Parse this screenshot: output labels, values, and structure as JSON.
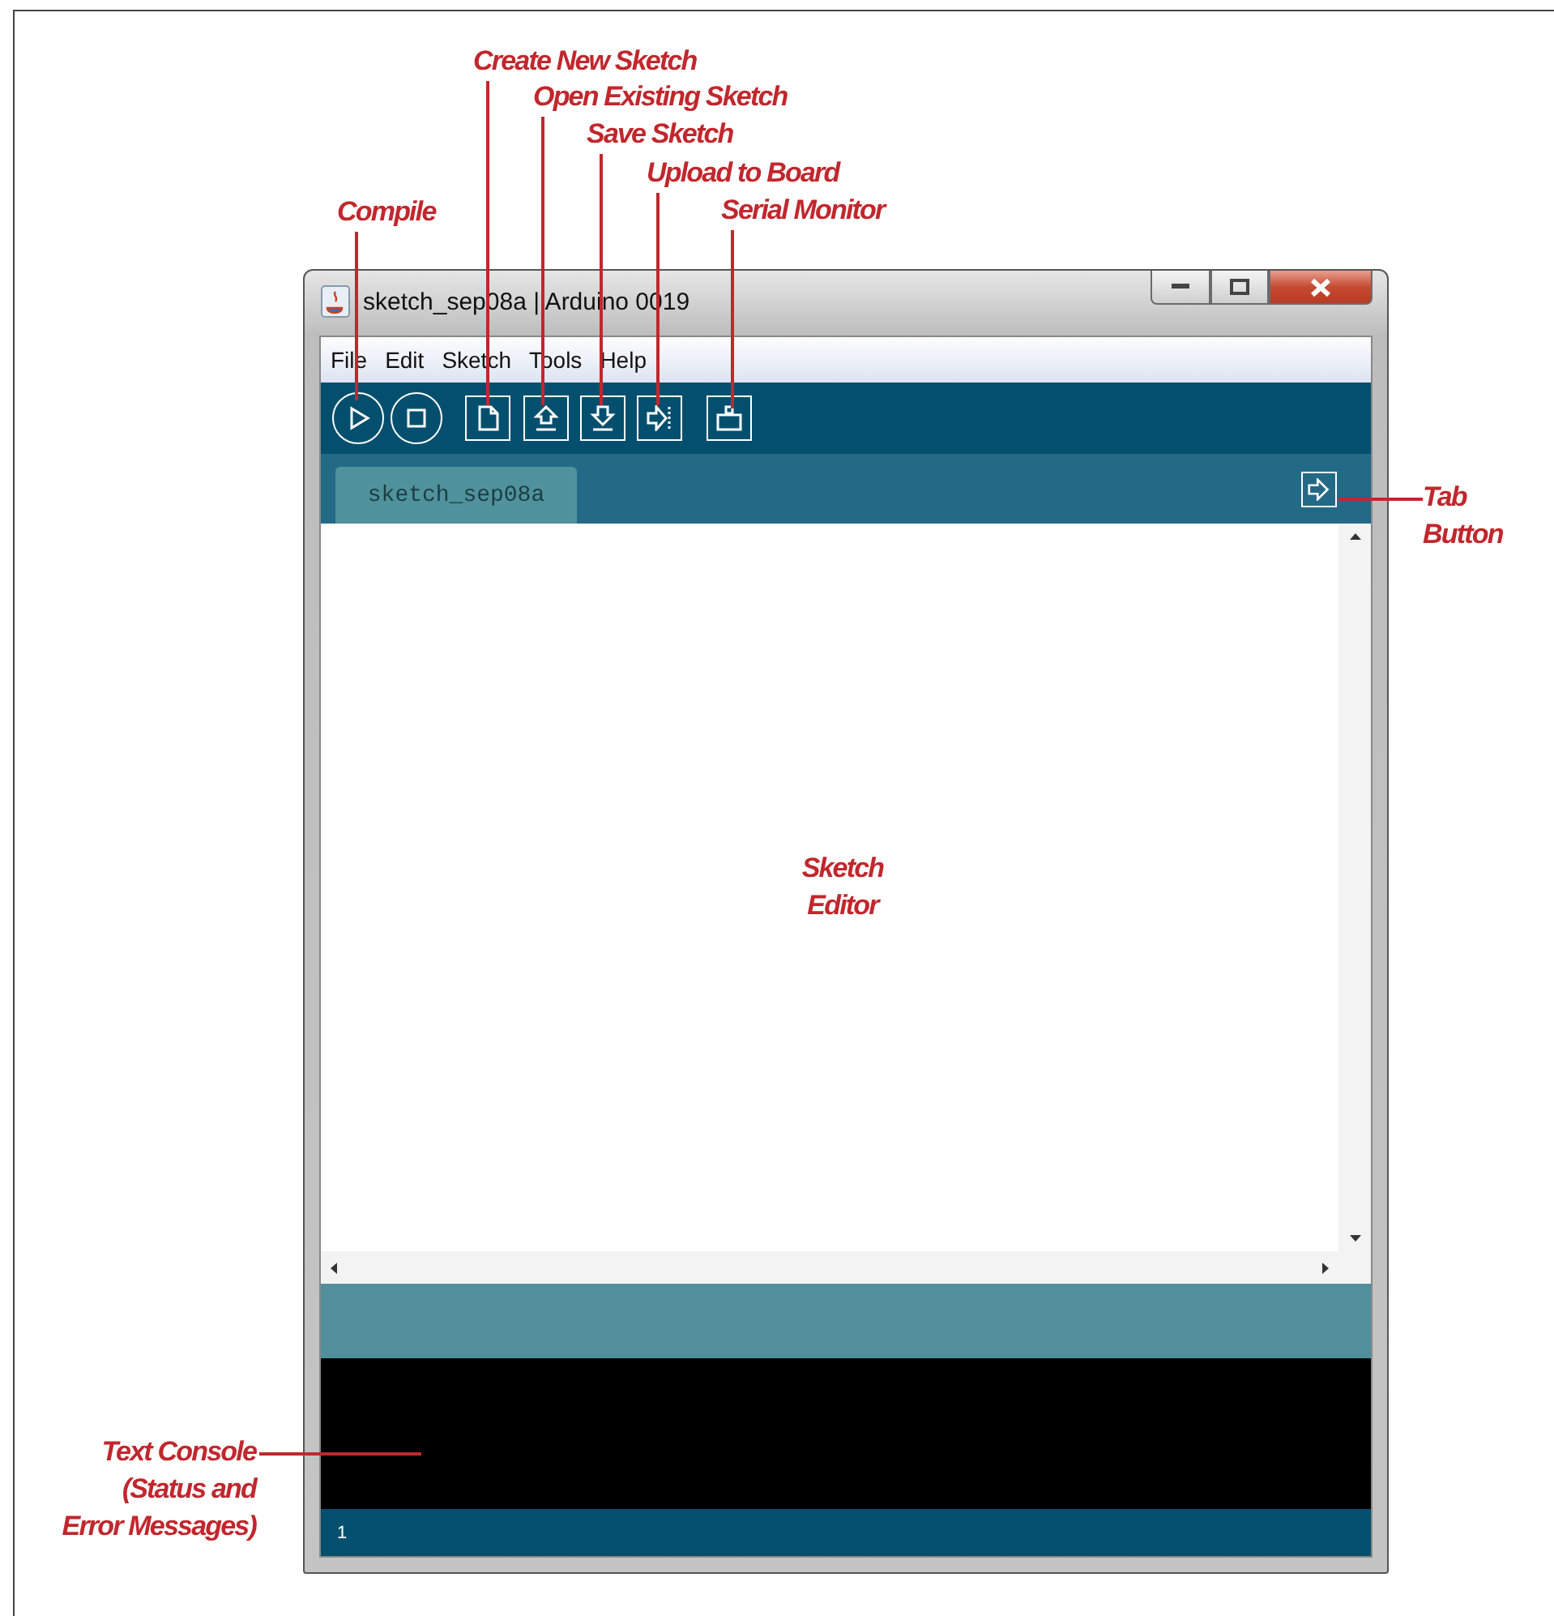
{
  "window": {
    "title": "sketch_sep08a | Arduino 0019"
  },
  "menu": [
    "File",
    "Edit",
    "Sketch",
    "Tools",
    "Help"
  ],
  "toolbar": [
    {
      "kind": "compile"
    },
    {
      "kind": "stop"
    },
    {
      "kind": "new"
    },
    {
      "kind": "open"
    },
    {
      "kind": "save"
    },
    {
      "kind": "upload"
    },
    {
      "kind": "serial"
    }
  ],
  "tabs": [
    {
      "label": "sketch_sep08a",
      "selected": true
    }
  ],
  "console": {
    "line_number": "1"
  },
  "callouts": [
    {
      "lines": [
        "Compile"
      ]
    },
    {
      "lines": [
        "Create New Sketch"
      ]
    },
    {
      "lines": [
        "Open Existing Sketch"
      ]
    },
    {
      "lines": [
        "Save Sketch"
      ]
    },
    {
      "lines": [
        "Upload to Board"
      ]
    },
    {
      "lines": [
        "Serial Monitor"
      ]
    },
    {
      "lines": [
        "Tab",
        "Button"
      ]
    },
    {
      "lines": [
        "Sketch",
        "Editor"
      ]
    },
    {
      "lines": [
        "Text Console",
        "(Status and",
        "Error Messages)"
      ]
    }
  ]
}
